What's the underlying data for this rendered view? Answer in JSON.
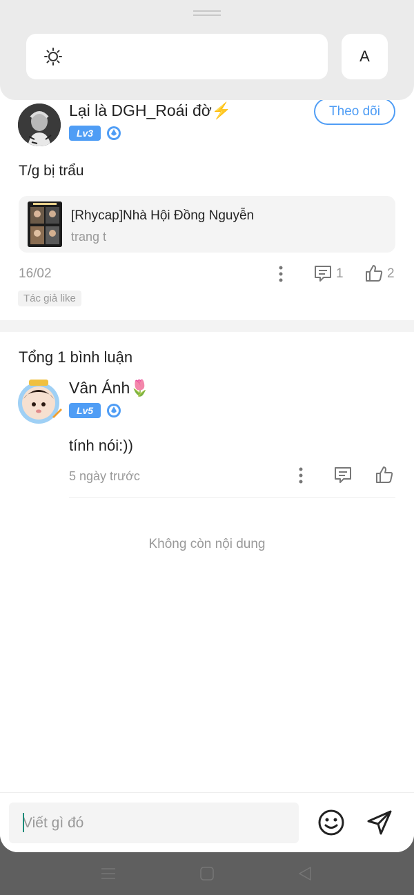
{
  "top_panel": {
    "brightness_icon": "sun-icon",
    "font_button_label": "A"
  },
  "post": {
    "author": "Lại là DGH_Roái đờ⚡",
    "level": "Lv3",
    "follow_label": "Theo dõi",
    "text": "T/g bị trẩu",
    "book": {
      "title": "[Rhycap]Nhà Hội Đồng Nguyễn",
      "subtitle": "trang t"
    },
    "date": "16/02",
    "comment_count": "1",
    "like_count": "2",
    "tag": "Tác giả like"
  },
  "comments": {
    "total_label": "Tổng 1 bình luận",
    "items": [
      {
        "author": "Vân Ánh🌷",
        "level": "Lv5",
        "text": "tính nói:))",
        "time": "5 ngày trước"
      }
    ],
    "end_label": "Không còn nội dung"
  },
  "input": {
    "placeholder": "Viết gì đó"
  },
  "colors": {
    "accent": "#4f9df5",
    "muted_text": "#999999",
    "caret": "#1a8c7a"
  }
}
